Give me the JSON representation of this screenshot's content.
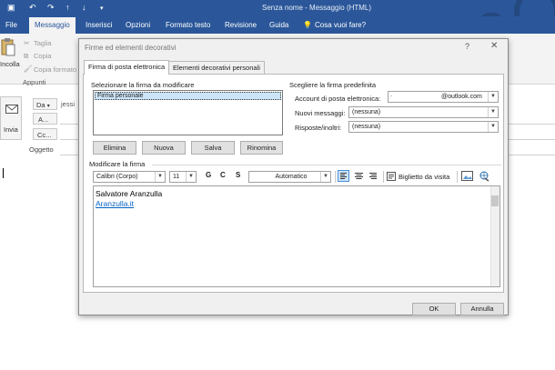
{
  "window": {
    "title": "Senza nome  -  Messaggio (HTML)"
  },
  "colors": {
    "accent": "#2b579a"
  },
  "ribbon": {
    "tabs": [
      "File",
      "Messaggio",
      "Inserisci",
      "Opzioni",
      "Formato testo",
      "Revisione",
      "Guida"
    ],
    "search_label": "Cosa vuoi fare?",
    "clipboard": {
      "paste": "Incolla",
      "cut": "Taglia",
      "copy": "Copia",
      "format_painter": "Copia formato",
      "group": "Appunti"
    }
  },
  "compose": {
    "from_label": "Da",
    "from_value": "jessi",
    "send_label": "Invia",
    "to_label": "A...",
    "cc_label": "Cc...",
    "subject_label": "Oggetto"
  },
  "dialog": {
    "title": "Firme ed elementi decorativi",
    "help": "?",
    "close": "✕",
    "tabs": [
      "Firma di posta elettronica",
      "Elementi decorativi personali"
    ],
    "select_label": "Selezionare la firma da modificare",
    "signatures": [
      "Firma personale"
    ],
    "buttons": {
      "delete": "Elimina",
      "new": "Nuova",
      "save": "Salva",
      "rename": "Rinomina"
    },
    "default_label": "Scegliere la firma predefinita",
    "account_label": "Account di posta elettronica:",
    "account_value": "@outlook.com",
    "new_messages_label": "Nuovi messaggi:",
    "new_messages_value": "(nessuna)",
    "replies_label": "Risposte/inoltri:",
    "replies_value": "(nessuna)",
    "edit_label": "Modificare la firma",
    "font": "Calibri (Corpo)",
    "size": "11",
    "bold": "G",
    "italic": "C",
    "underline": "S",
    "color": "Automatico",
    "business_card": "Biglietto da visita",
    "signature_name": "Salvatore Aranzulla",
    "signature_link": "Aranzulla.it",
    "ok": "OK",
    "cancel": "Annulla"
  }
}
